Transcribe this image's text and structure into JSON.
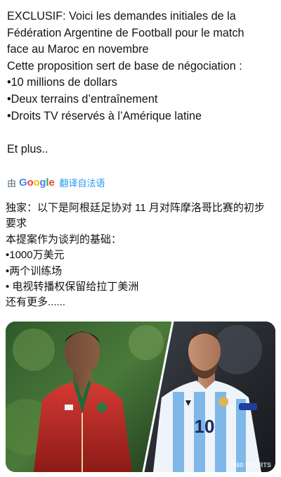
{
  "tweet": {
    "lines": [
      "EXCLUSIF: Voici les demandes initiales de la",
      "Fédération Argentine de Football pour le match",
      "face au Maroc en novembre",
      "Cette proposition sert de base de négociation :",
      "•10 millions de dollars",
      "•Deux terrains d’entraînement",
      "•Droits TV réservés à l’Amérique latine",
      "Et plus.."
    ]
  },
  "translate": {
    "by_label": "由",
    "provider": "Google",
    "link_label": "翻译自法语"
  },
  "translation": {
    "lines": [
      "独家：以下是阿根廷足协对 11 月对阵摩洛哥比赛的初步",
      "要求",
      "本提案作为谈判的基础：",
      "•1000万美元",
      "•两个训练场",
      "• 电视转播权保留给拉丁美洲",
      "还有更多......"
    ]
  },
  "media": {
    "watermark": "360 SPORTS",
    "left_player": {
      "jersey_color": "#c62a2a",
      "number": ""
    },
    "right_player": {
      "jersey_color": "#7fb8e8",
      "number": "10"
    }
  }
}
